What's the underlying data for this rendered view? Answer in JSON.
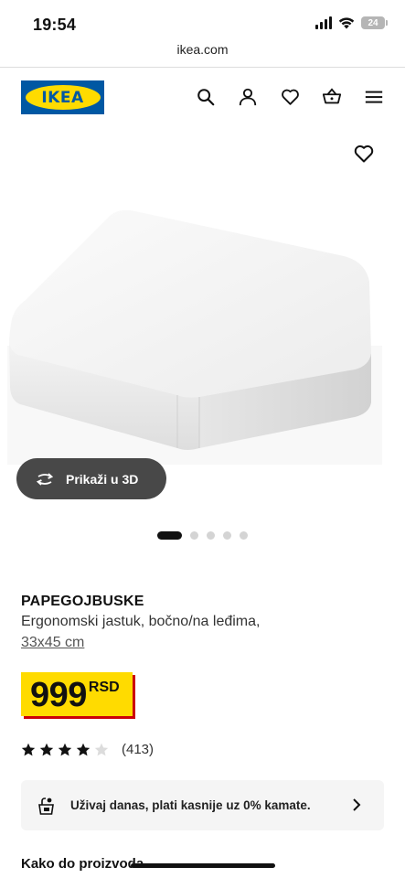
{
  "status_bar": {
    "time": "19:54",
    "battery": "24"
  },
  "browser": {
    "url": "ikea.com"
  },
  "header": {
    "logo": "IKEA",
    "icons": [
      "search-icon",
      "account-icon",
      "favourites-icon",
      "shopping-basket-icon",
      "menu-icon"
    ]
  },
  "gallery": {
    "view_3d_label": "Prikaži u 3D",
    "image_count": 5,
    "active_image": 1
  },
  "product": {
    "name": "PAPEGOJBUSKE",
    "description": "Ergonomski jastuk, bočno/na leđima,",
    "size": "33x45 cm",
    "price": "999",
    "currency": "RSD",
    "rating": 4,
    "rating_max": 5,
    "review_count": "(413)"
  },
  "promo": {
    "text": "Uživaj danas, plati kasnije uz 0% kamate."
  },
  "section": {
    "title": "Kako do proizvoda"
  },
  "colors": {
    "ikea_blue": "#0058a3",
    "ikea_yellow": "#ffdb00",
    "price_shadow": "#cc0008"
  }
}
